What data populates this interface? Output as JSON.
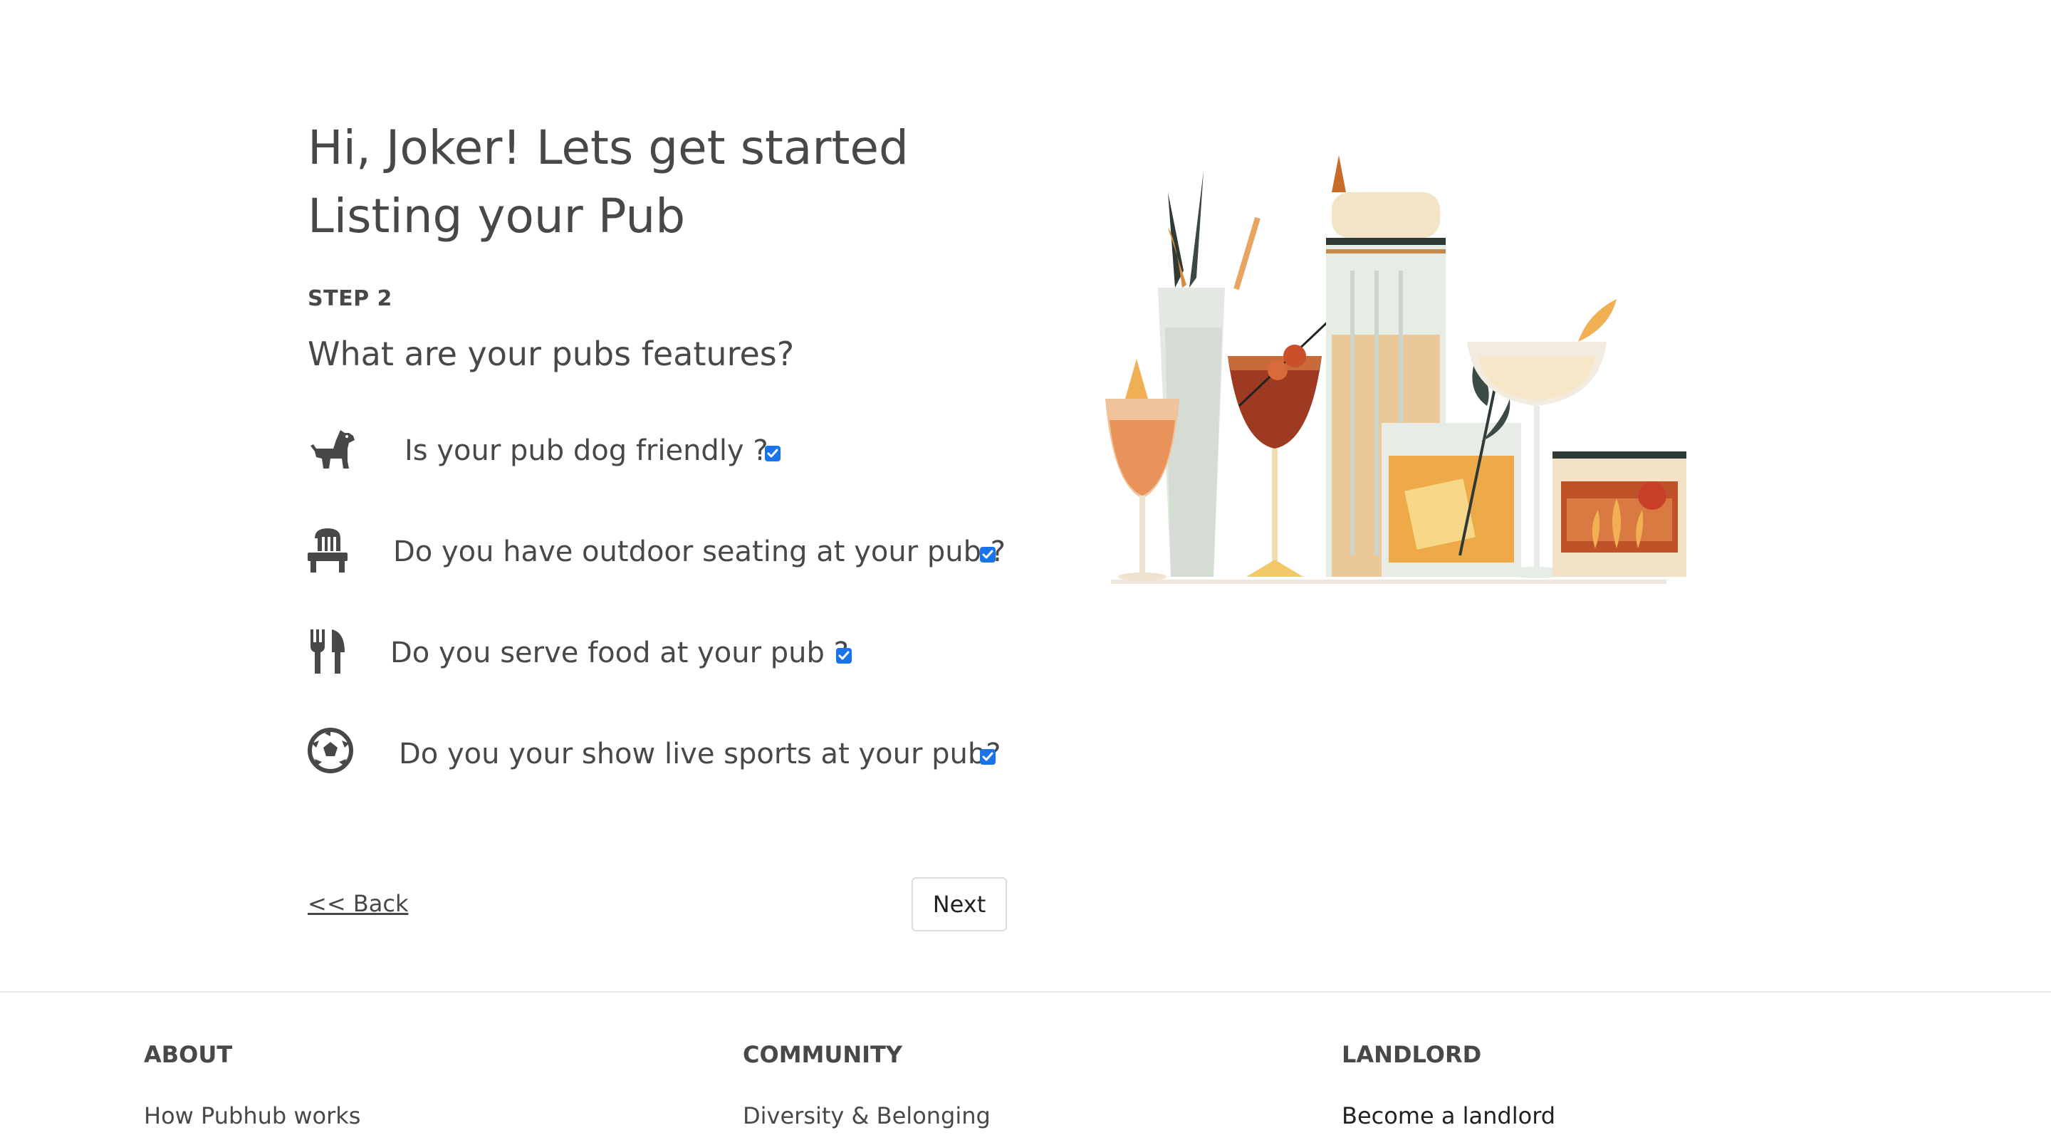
{
  "header": {
    "title": "Hi, Joker! Lets get started Listing your Pub",
    "step": "STEP 2",
    "question": "What are your pubs features?"
  },
  "features": [
    {
      "icon": "dog-icon",
      "label": "Is your pub dog friendly ?",
      "checked": true
    },
    {
      "icon": "chair-icon",
      "label": "Do you have outdoor seating at your pub ?",
      "checked": true
    },
    {
      "icon": "fork-knife-icon",
      "label": "Do you serve food at your pub ?",
      "checked": true
    },
    {
      "icon": "soccer-ball-icon",
      "label": "Do you your show live sports at your pub?",
      "checked": true
    }
  ],
  "nav": {
    "back_label": "<< Back",
    "next_label": "Next"
  },
  "footer": {
    "columns": [
      {
        "heading": "ABOUT",
        "links": [
          "How Pubhub works"
        ]
      },
      {
        "heading": "COMMUNITY",
        "links": [
          "Diversity & Belonging"
        ]
      },
      {
        "heading": "LANDLORD",
        "links": [
          "Become a landlord"
        ]
      }
    ]
  },
  "colors": {
    "text": "#484848",
    "checkbox": "#1a73e8",
    "divider": "#ebebeb"
  }
}
